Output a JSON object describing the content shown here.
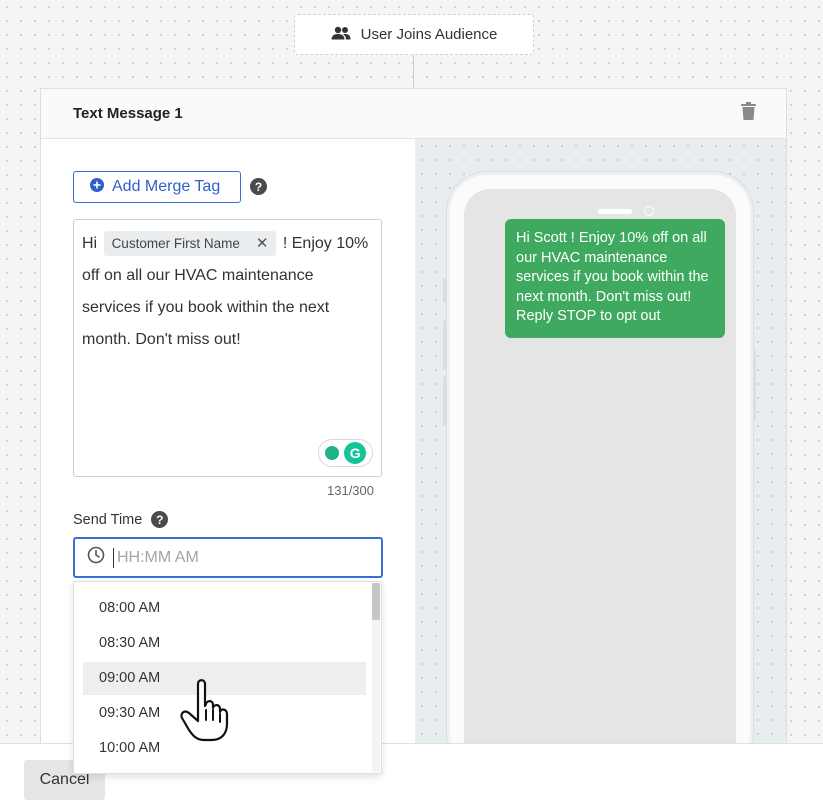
{
  "trigger": {
    "label": "User Joins Audience",
    "icon": "people-icon"
  },
  "card": {
    "title": "Text Message 1",
    "delete_icon": "trash-icon"
  },
  "editor": {
    "merge_button_label": "Add Merge Tag",
    "help_glyph": "?",
    "text_before": "Hi",
    "merge_tag_label": "Customer First Name",
    "text_after": "! Enjoy 10% off on all our HVAC maintenance services if you book within the next month. Don't miss out!",
    "char_count": "131/300",
    "grammarly_glyph": "G"
  },
  "send_time": {
    "label": "Send Time",
    "placeholder": "HH:MM AM",
    "options": [
      "08:00 AM",
      "08:30 AM",
      "09:00 AM",
      "09:30 AM",
      "10:00 AM"
    ],
    "hovered_option": "09:00 AM"
  },
  "preview": {
    "message": "Hi Scott ! Enjoy 10% off on all our HVAC maintenance services if you book within the next month. Don't miss out! Reply STOP to opt out"
  },
  "footer": {
    "cancel_label": "Cancel"
  },
  "colors": {
    "accent": "#3a6ed8",
    "bubble": "#3fa95f",
    "grammarly": "#15c39a"
  }
}
